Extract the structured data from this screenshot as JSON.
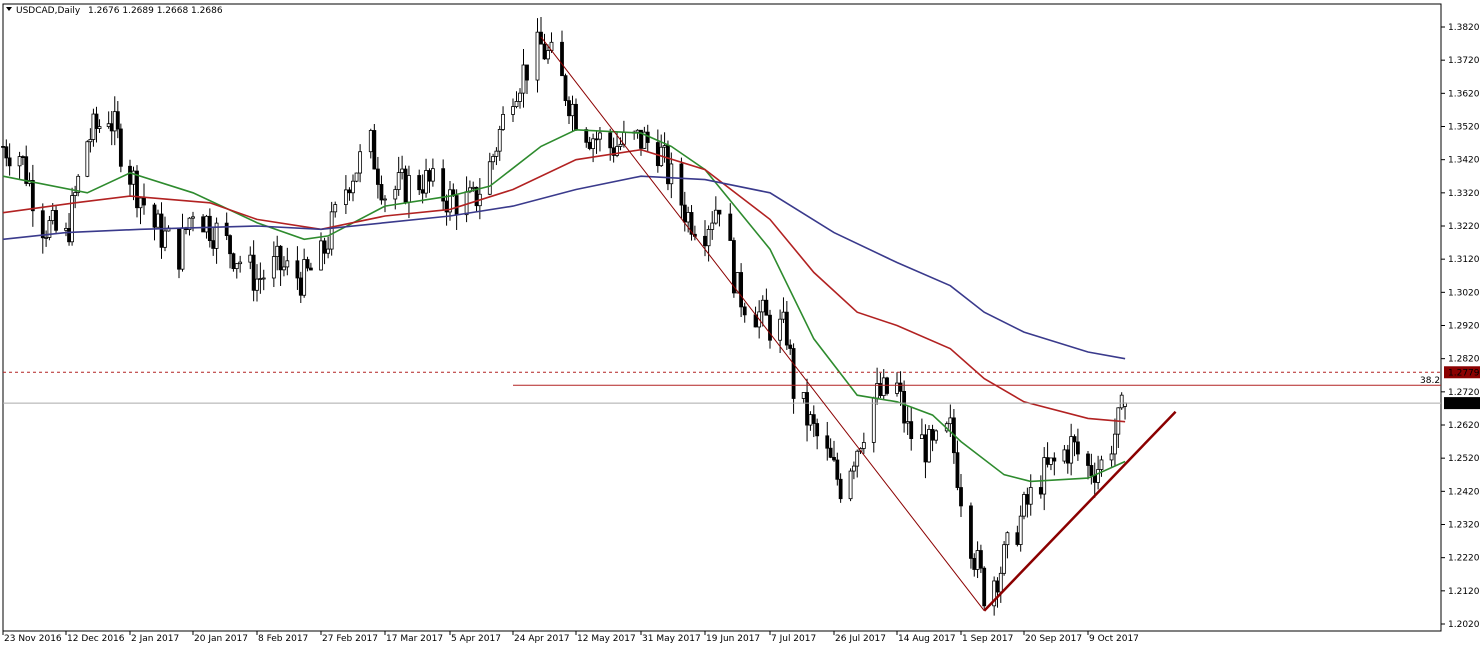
{
  "header": {
    "symbol": "USDCAD,Daily",
    "ohlc": "1.2676 1.2689 1.2668 1.2686"
  },
  "price_tags": {
    "fib_level": "1.2779",
    "current": "1.2686",
    "fib_label": "38.2"
  },
  "colors": {
    "background": "#ffffff",
    "candles": "#000000",
    "ma_fast": "#2e8b2e",
    "ma_mid": "#b22222",
    "ma_slow": "#3a3a8c",
    "trendline": "#8b0000",
    "fib_tag": "#8b0000",
    "current_tag": "#000000"
  },
  "chart_data": {
    "type": "candlestick",
    "symbol": "USDCAD",
    "timeframe": "Daily",
    "ylim": [
      1.202,
      1.382
    ],
    "y_ticks": [
      "1.3820",
      "1.3720",
      "1.3620",
      "1.3520",
      "1.3420",
      "1.3320",
      "1.3220",
      "1.3120",
      "1.3020",
      "1.2920",
      "1.2820",
      "1.2720",
      "1.2620",
      "1.2520",
      "1.2420",
      "1.2320",
      "1.2220",
      "1.2120",
      "1.2020"
    ],
    "x_ticks": [
      "23 Nov 2016",
      "12 Dec 2016",
      "2 Jan 2017",
      "20 Jan 2017",
      "8 Feb 2017",
      "27 Feb 2017",
      "17 Mar 2017",
      "5 Apr 2017",
      "24 Apr 2017",
      "12 May 2017",
      "31 May 2017",
      "19 Jun 2017",
      "7 Jul 2017",
      "26 Jul 2017",
      "14 Aug 2017",
      "1 Sep 2017",
      "20 Sep 2017",
      "9 Oct 2017"
    ],
    "close_anchors": [
      [
        "23 Nov 2016",
        1.346
      ],
      [
        "28 Nov 2016",
        1.344
      ],
      [
        "5 Dec 2016",
        1.323
      ],
      [
        "12 Dec 2016",
        1.318
      ],
      [
        "19 Dec 2016",
        1.348
      ],
      [
        "26 Dec 2016",
        1.356
      ],
      [
        "2 Jan 2017",
        1.338
      ],
      [
        "9 Jan 2017",
        1.322
      ],
      [
        "16 Jan 2017",
        1.314
      ],
      [
        "20 Jan 2017",
        1.328
      ],
      [
        "27 Jan 2017",
        1.32
      ],
      [
        "8 Feb 2017",
        1.306
      ],
      [
        "14 Feb 2017",
        1.31
      ],
      [
        "22 Feb 2017",
        1.306
      ],
      [
        "27 Feb 2017",
        1.312
      ],
      [
        "7 Mar 2017",
        1.337
      ],
      [
        "13 Mar 2017",
        1.346
      ],
      [
        "17 Mar 2017",
        1.332
      ],
      [
        "28 Mar 2017",
        1.336
      ],
      [
        "5 Apr 2017",
        1.33
      ],
      [
        "12 Apr 2017",
        1.329
      ],
      [
        "17 Apr 2017",
        1.34
      ],
      [
        "24 Apr 2017",
        1.364
      ],
      [
        "28 Apr 2017",
        1.37
      ],
      [
        "2 May 2017",
        1.376
      ],
      [
        "5 May 2017",
        1.372
      ],
      [
        "12 May 2017",
        1.356
      ],
      [
        "16 May 2017",
        1.35
      ],
      [
        "22 May 2017",
        1.346
      ],
      [
        "31 May 2017",
        1.348
      ],
      [
        "5 Jun 2017",
        1.346
      ],
      [
        "8 Jun 2017",
        1.338
      ],
      [
        "14 Jun 2017",
        1.325
      ],
      [
        "19 Jun 2017",
        1.322
      ],
      [
        "23 Jun 2017",
        1.33
      ],
      [
        "28 Jun 2017",
        1.302
      ],
      [
        "7 Jul 2017",
        1.292
      ],
      [
        "12 Jul 2017",
        1.29
      ],
      [
        "14 Jul 2017",
        1.273
      ],
      [
        "19 Jul 2017",
        1.262
      ],
      [
        "26 Jul 2017",
        1.248
      ],
      [
        "28 Jul 2017",
        1.244
      ],
      [
        "2 Aug 2017",
        1.256
      ],
      [
        "7 Aug 2017",
        1.27
      ],
      [
        "14 Aug 2017",
        1.273
      ],
      [
        "17 Aug 2017",
        1.26
      ],
      [
        "24 Aug 2017",
        1.254
      ],
      [
        "29 Aug 2017",
        1.26
      ],
      [
        "1 Sep 2017",
        1.242
      ],
      [
        "5 Sep 2017",
        1.223
      ],
      [
        "8 Sep 2017",
        1.212
      ],
      [
        "13 Sep 2017",
        1.219
      ],
      [
        "20 Sep 2017",
        1.236
      ],
      [
        "25 Sep 2017",
        1.246
      ],
      [
        "28 Sep 2017",
        1.249
      ],
      [
        "4 Oct 2017",
        1.256
      ],
      [
        "9 Oct 2017",
        1.249
      ],
      [
        "13 Oct 2017",
        1.25
      ],
      [
        "18 Oct 2017",
        1.262
      ],
      [
        "20 Oct 2017",
        1.2686
      ]
    ],
    "series": [
      {
        "name": "",
        "kind": "moving_average",
        "color": "#2e8b2e",
        "points": [
          [
            "23 Nov 2016",
            1.337
          ],
          [
            "19 Dec 2016",
            1.332
          ],
          [
            "2 Jan 2017",
            1.338
          ],
          [
            "20 Jan 2017",
            1.332
          ],
          [
            "8 Feb 2017",
            1.323
          ],
          [
            "22 Feb 2017",
            1.318
          ],
          [
            "1 Mar 2017",
            1.319
          ],
          [
            "17 Mar 2017",
            1.328
          ],
          [
            "5 Apr 2017",
            1.331
          ],
          [
            "17 Apr 2017",
            1.334
          ],
          [
            "2 May 2017",
            1.346
          ],
          [
            "12 May 2017",
            1.351
          ],
          [
            "31 May 2017",
            1.35
          ],
          [
            "9 Jun 2017",
            1.346
          ],
          [
            "19 Jun 2017",
            1.339
          ],
          [
            "7 Jul 2017",
            1.315
          ],
          [
            "20 Jul 2017",
            1.288
          ],
          [
            "2 Aug 2017",
            1.271
          ],
          [
            "14 Aug 2017",
            1.269
          ],
          [
            "24 Aug 2017",
            1.265
          ],
          [
            "1 Sep 2017",
            1.257
          ],
          [
            "14 Sep 2017",
            1.247
          ],
          [
            "22 Sep 2017",
            1.245
          ],
          [
            "9 Oct 2017",
            1.246
          ],
          [
            "20 Oct 2017",
            1.251
          ]
        ]
      },
      {
        "name": "",
        "kind": "moving_average",
        "color": "#b22222",
        "points": [
          [
            "23 Nov 2016",
            1.326
          ],
          [
            "15 Dec 2016",
            1.329
          ],
          [
            "2 Jan 2017",
            1.331
          ],
          [
            "25 Jan 2017",
            1.329
          ],
          [
            "8 Feb 2017",
            1.324
          ],
          [
            "27 Feb 2017",
            1.321
          ],
          [
            "17 Mar 2017",
            1.325
          ],
          [
            "5 Apr 2017",
            1.327
          ],
          [
            "24 Apr 2017",
            1.333
          ],
          [
            "12 May 2017",
            1.342
          ],
          [
            "31 May 2017",
            1.345
          ],
          [
            "19 Jun 2017",
            1.339
          ],
          [
            "7 Jul 2017",
            1.324
          ],
          [
            "20 Jul 2017",
            1.308
          ],
          [
            "2 Aug 2017",
            1.296
          ],
          [
            "14 Aug 2017",
            1.292
          ],
          [
            "29 Aug 2017",
            1.285
          ],
          [
            "8 Sep 2017",
            1.276
          ],
          [
            "20 Sep 2017",
            1.269
          ],
          [
            "9 Oct 2017",
            1.264
          ],
          [
            "20 Oct 2017",
            1.263
          ]
        ]
      },
      {
        "name": "",
        "kind": "moving_average",
        "color": "#3a3a8c",
        "points": [
          [
            "23 Nov 2016",
            1.318
          ],
          [
            "12 Dec 2016",
            1.32
          ],
          [
            "5 Jan 2017",
            1.321
          ],
          [
            "8 Feb 2017",
            1.322
          ],
          [
            "27 Feb 2017",
            1.321
          ],
          [
            "17 Mar 2017",
            1.323
          ],
          [
            "5 Apr 2017",
            1.325
          ],
          [
            "24 Apr 2017",
            1.328
          ],
          [
            "12 May 2017",
            1.333
          ],
          [
            "31 May 2017",
            1.337
          ],
          [
            "19 Jun 2017",
            1.336
          ],
          [
            "7 Jul 2017",
            1.332
          ],
          [
            "26 Jul 2017",
            1.32
          ],
          [
            "14 Aug 2017",
            1.311
          ],
          [
            "29 Aug 2017",
            1.304
          ],
          [
            "8 Sep 2017",
            1.296
          ],
          [
            "20 Sep 2017",
            1.29
          ],
          [
            "9 Oct 2017",
            1.284
          ],
          [
            "20 Oct 2017",
            1.282
          ]
        ]
      }
    ],
    "annotations": {
      "fib_line": {
        "y": 1.274,
        "from": "24 Apr 2017",
        "label": "38.2"
      },
      "fib_dotted_level": 1.2779,
      "current_price_line": 1.2686,
      "trendlines": [
        {
          "from": [
            "2 May 2017",
            1.379
          ],
          "to": [
            "8 Sep 2017",
            1.206
          ],
          "style": "thin"
        },
        {
          "from": [
            "8 Sep 2017",
            1.206
          ],
          "to": [
            "4 Nov 2017",
            1.266
          ],
          "style": "thick"
        }
      ]
    }
  }
}
